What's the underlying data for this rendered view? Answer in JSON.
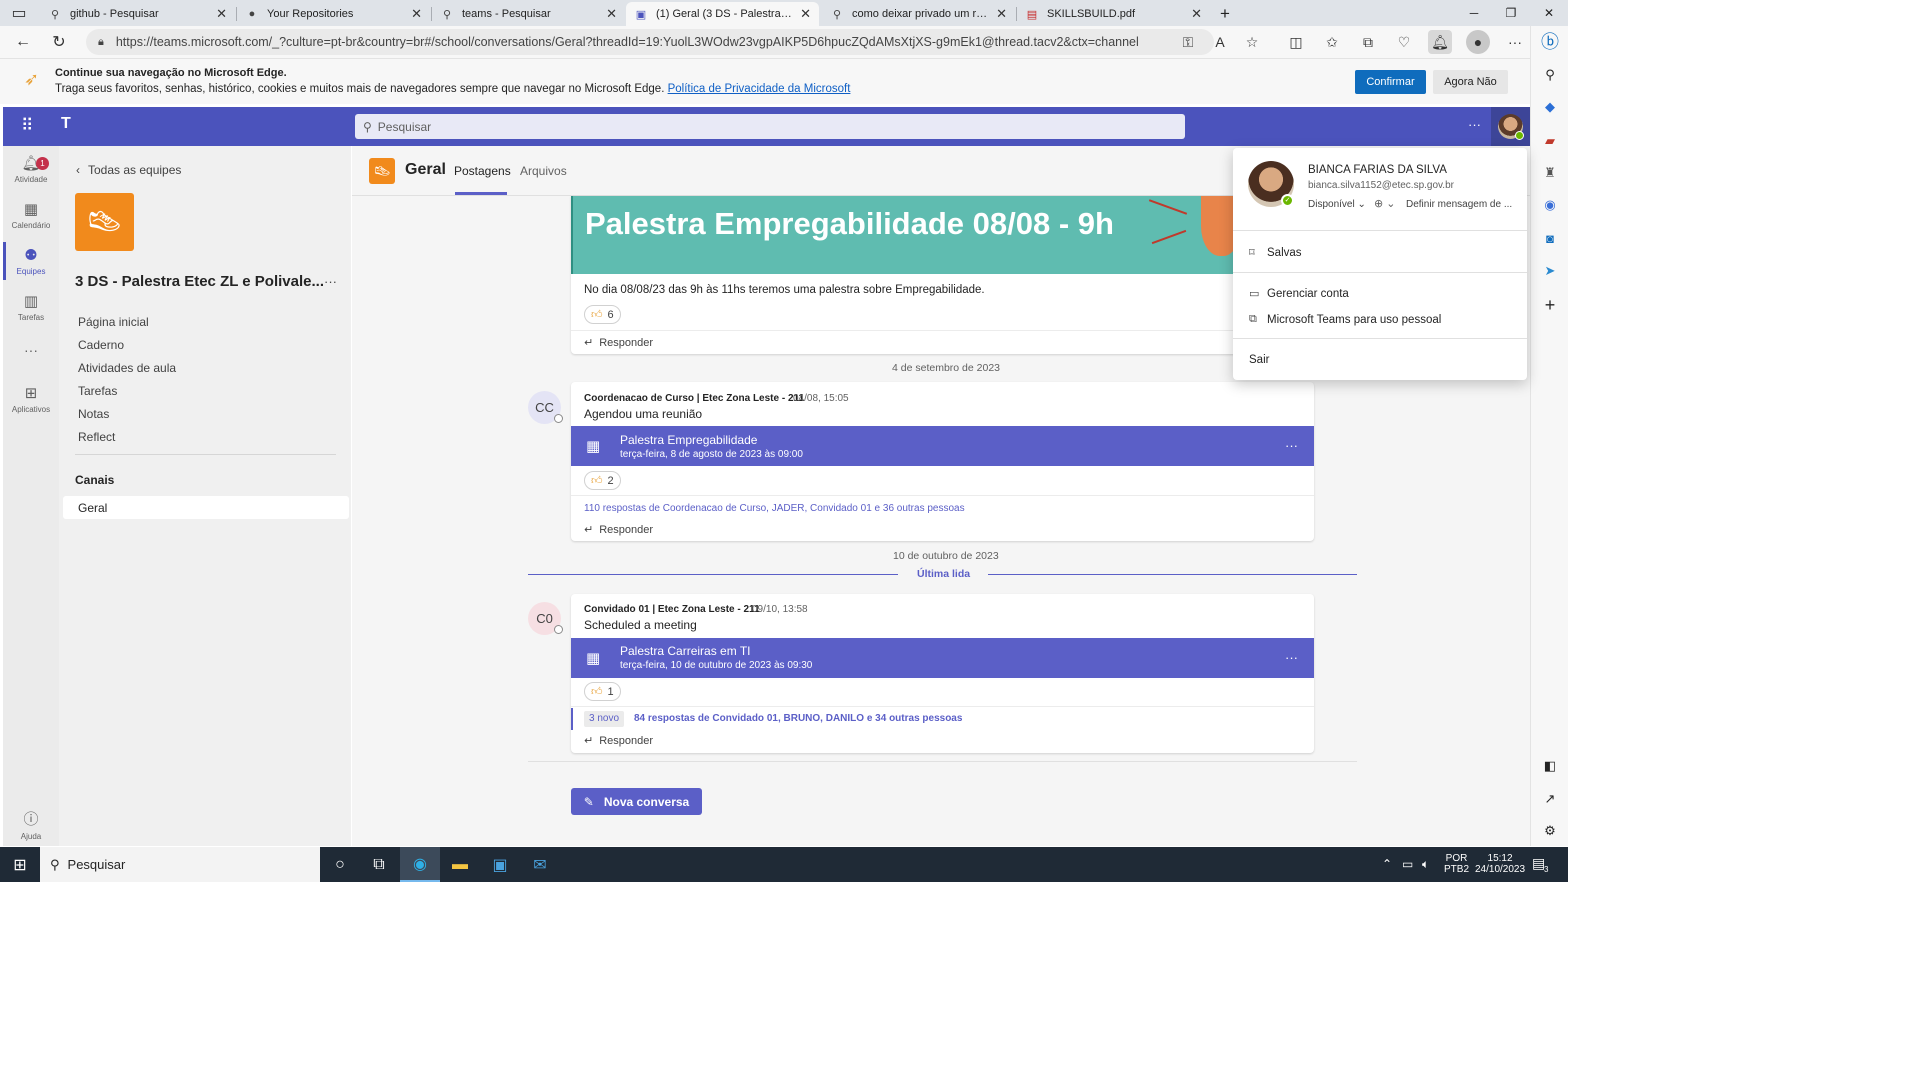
{
  "browser": {
    "tabs": [
      {
        "label": "github - Pesquisar",
        "icon": "search-icon"
      },
      {
        "label": "Your Repositories",
        "icon": "github-icon"
      },
      {
        "label": "teams - Pesquisar",
        "icon": "search-icon"
      },
      {
        "label": "(1) Geral (3 DS - Palestra Etec ZL",
        "icon": "teams-icon"
      },
      {
        "label": "como deixar privado um reposit…",
        "icon": "search-icon"
      },
      {
        "label": "SKILLSBUILD.pdf",
        "icon": "pdf-icon"
      }
    ],
    "new_tab": "+",
    "url": "https://teams.microsoft.com/_?culture=pt-br&country=br#/school/conversations/Geral?threadId=19:YuolL3WOdw23vgpAIKP5D6hpucZQdAMsXtjXS-g9mEk1@thread.tacv2&ctx=channel",
    "infobar": {
      "title": "Continue sua navegação no Microsoft Edge.",
      "text": "Traga seus favoritos, senhas, histórico, cookies e muitos mais de navegadores sempre que navegar no Microsoft Edge.",
      "link": "Política de Privacidade da Microsoft",
      "confirm": "Confirmar",
      "later": "Agora Não"
    }
  },
  "teams": {
    "search_placeholder": "Pesquisar",
    "more": "···",
    "rail": [
      {
        "label": "Atividade",
        "badge": "1"
      },
      {
        "label": "Calendário"
      },
      {
        "label": "Equipes"
      },
      {
        "label": "Tarefas"
      },
      {
        "label": "···"
      },
      {
        "label": "Aplicativos"
      },
      {
        "label": "Ajuda"
      }
    ],
    "left": {
      "back": "Todas as equipes",
      "team_name": "3 DS - Palestra Etec ZL e Polivale...",
      "more": "···",
      "nav": [
        "Página inicial",
        "Caderno",
        "Atividades de aula",
        "Tarefas",
        "Notas",
        "Reflect"
      ],
      "channels_header": "Canais",
      "channel": "Geral"
    },
    "channel_header": {
      "name": "Geral",
      "tabs": [
        "Postagens",
        "Arquivos"
      ]
    },
    "post1": {
      "banner_title": "Palestra Empregabilidade 08/08 - 9h",
      "text": "No dia 08/08/23 das 9h às 11hs teremos uma palestra sobre Empregabilidade.",
      "reaction_count": "6",
      "reply": "Responder"
    },
    "date_sep1": "4 de setembro de 2023",
    "post2": {
      "avatar": "CC",
      "author": "Coordenacao de Curso | Etec Zona Leste - 211",
      "time": "04/08, 15:05",
      "text": "Agendou uma reunião",
      "meeting_title": "Palestra Empregabilidade",
      "meeting_date": "terça-feira, 8 de agosto de 2023 às 09:00",
      "meeting_more": "···",
      "reaction_count": "2",
      "replies": "110 respostas de Coordenacao de Curso, JADER, Convidado 01 e 36 outras pessoas",
      "reply": "Responder"
    },
    "date_sep2": "10 de outubro de 2023",
    "last_read": "Última lida",
    "post3": {
      "avatar": "C0",
      "author": "Convidado 01 | Etec Zona Leste - 211",
      "time": "09/10, 13:58",
      "text": "Scheduled a meeting",
      "meeting_title": "Palestra Carreiras em TI",
      "meeting_date": "terça-feira, 10 de outubro de 2023 às 09:30",
      "meeting_more": "···",
      "reaction_count": "1",
      "new_badge": "3 novo",
      "replies": "84 respostas de Convidado 01, BRUNO, DANILO e 34 outras pessoas",
      "reply": "Responder"
    },
    "new_conversation": "Nova conversa",
    "profile": {
      "name": "BIANCA FARIAS DA SILVA",
      "email": "bianca.silva1152@etec.sp.gov.br",
      "status": "Disponível",
      "status_msg": "Definir mensagem de ...",
      "saved": "Salvas",
      "manage": "Gerenciar conta",
      "personal": "Microsoft Teams para uso pessoal",
      "signout": "Sair"
    }
  },
  "taskbar": {
    "search": "Pesquisar",
    "lang1": "POR",
    "lang2": "PTB2",
    "time": "15:12",
    "date": "24/10/2023",
    "notif": "3"
  },
  "colors": {
    "teams_purple": "#4b53bc",
    "meeting_purple": "#5b5fc7",
    "banner_teal": "#5fbcb0",
    "edge_blue": "#0f6cbd"
  }
}
